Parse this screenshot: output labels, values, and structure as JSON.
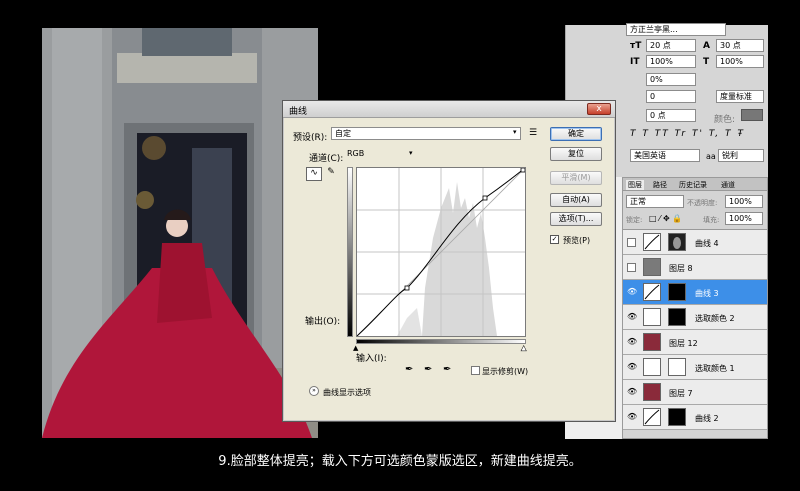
{
  "caption": "9.脸部整体提亮；载入下方可选颜色蒙版选区，新建曲线提亮。",
  "dialog": {
    "title": "曲线",
    "close_label": "x",
    "preset_label": "预设(R):",
    "preset_value": "自定",
    "channel_label": "通道(C):",
    "channel_value": "RGB",
    "output_label": "输出(O):",
    "input_label": "输入(I):",
    "show_clipping": "显示修剪(W)",
    "display_options": "曲线显示选项",
    "buttons": {
      "ok": "确定",
      "reset": "复位",
      "smooth": "平滑(M)",
      "auto": "自动(A)",
      "options": "选项(T)...",
      "preview": "预览(P)"
    }
  },
  "character_panel": {
    "font": "方正兰亭黑...",
    "size": "20 点",
    "leading": "30 点",
    "vscale": "100%",
    "hscale": "100%",
    "tracking_pct": "0%",
    "kerning": "0",
    "kerning_mode": "度量标准",
    "baseline": "0 点",
    "color_label": "颜色:",
    "styles": [
      "T",
      "T",
      "TT",
      "Tr",
      "T'",
      "T,",
      "T",
      "Ŧ"
    ],
    "language": "美国英语",
    "aa_label": "aa",
    "aa_value": "锐利"
  },
  "layers_panel": {
    "tabs": [
      "图层",
      "路径",
      "历史记录",
      "通道"
    ],
    "blend_mode": "正常",
    "opacity_label": "不透明度:",
    "opacity_value": "100%",
    "lock_label": "锁定:",
    "fill_label": "填充:",
    "fill_value": "100%",
    "layers": [
      {
        "name": "曲线 4",
        "visible": false,
        "selected": false
      },
      {
        "name": "图层 8",
        "visible": false,
        "selected": false
      },
      {
        "name": "曲线 3",
        "visible": true,
        "selected": true
      },
      {
        "name": "选取颜色 2",
        "visible": true,
        "selected": false
      },
      {
        "name": "图层 12",
        "visible": true,
        "selected": false
      },
      {
        "name": "选取颜色 1",
        "visible": true,
        "selected": false
      },
      {
        "name": "图层 7",
        "visible": true,
        "selected": false
      },
      {
        "name": "曲线 2",
        "visible": true,
        "selected": false
      }
    ]
  },
  "colors": {
    "accent": "#3d8fe8",
    "dress": "#b0163a"
  }
}
